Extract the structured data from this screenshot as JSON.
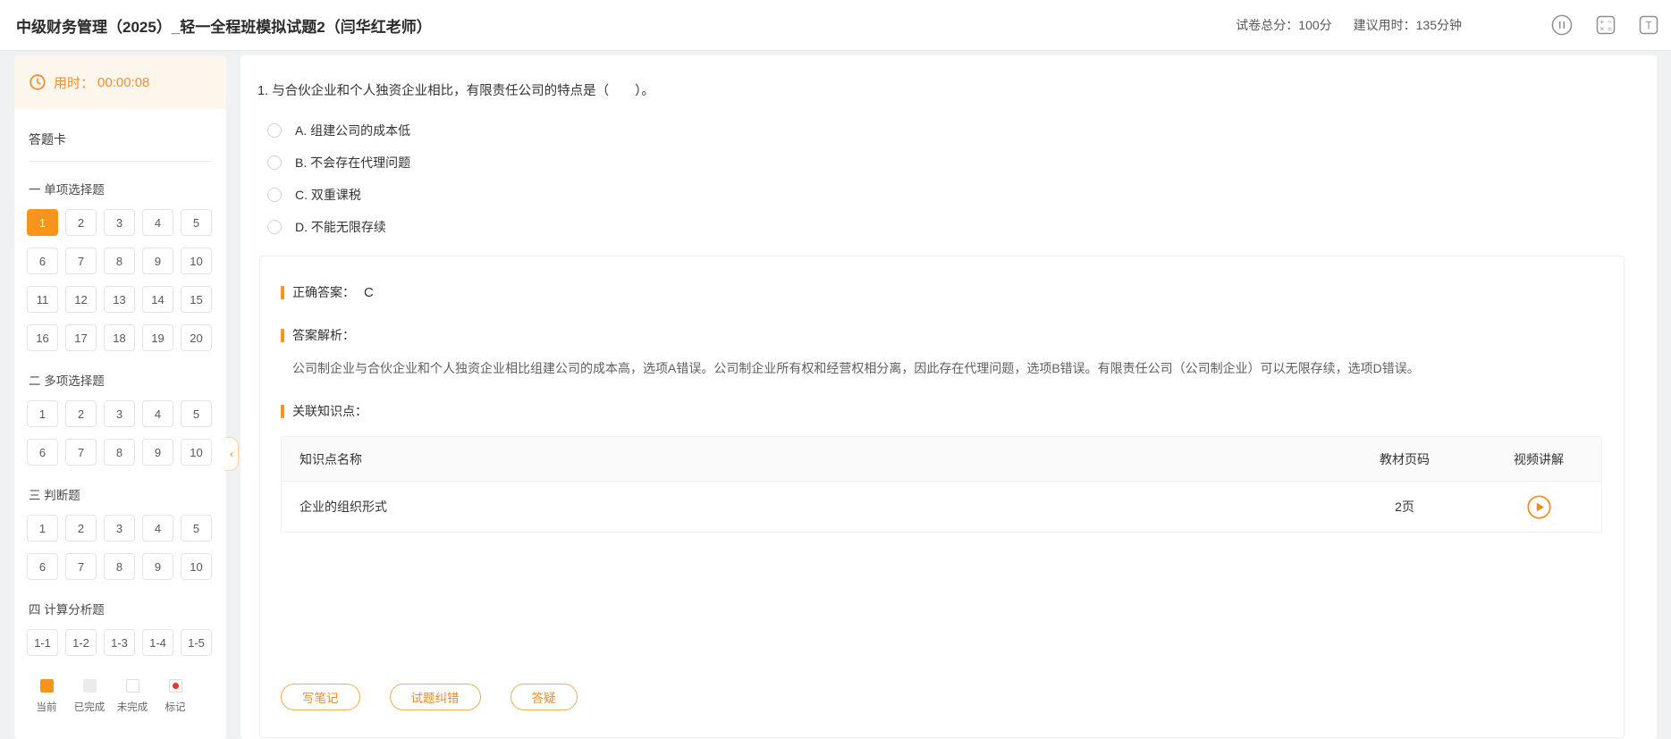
{
  "colors": {
    "accent_orange": "#f7941e",
    "timer_orange": "#ee8f33",
    "marked_red": "#e8382d"
  },
  "header": {
    "title": "中级财务管理（2025）_轻一全程班模拟试题2（闫华红老师）",
    "total_score": "试卷总分：100分",
    "suggested_time": "建议用时：135分钟",
    "icons": [
      "pause-icon",
      "calculator-icon",
      "font-size-icon"
    ]
  },
  "sidebar": {
    "timer": {
      "icon": "clock-icon",
      "label": "用时：",
      "value": "00:00:08"
    },
    "card_title": "答题卡",
    "sections": [
      {
        "title": "一 单项选择题",
        "active": "1",
        "items": [
          "1",
          "2",
          "3",
          "4",
          "5",
          "6",
          "7",
          "8",
          "9",
          "10",
          "11",
          "12",
          "13",
          "14",
          "15",
          "16",
          "17",
          "18",
          "19",
          "20"
        ]
      },
      {
        "title": "二 多项选择题",
        "items": [
          "1",
          "2",
          "3",
          "4",
          "5",
          "6",
          "7",
          "8",
          "9",
          "10"
        ]
      },
      {
        "title": "三 判断题",
        "items": [
          "1",
          "2",
          "3",
          "4",
          "5",
          "6",
          "7",
          "8",
          "9",
          "10"
        ]
      },
      {
        "title": "四 计算分析题",
        "items": [
          "1-1",
          "1-2",
          "1-3",
          "1-4",
          "1-5"
        ]
      }
    ],
    "legend": [
      {
        "type": "current",
        "label": "当前"
      },
      {
        "type": "done",
        "label": "已完成"
      },
      {
        "type": "todo",
        "label": "未完成"
      },
      {
        "type": "marked",
        "label": "标记"
      }
    ],
    "collapse_glyph": "‹"
  },
  "question": {
    "text": "1. 与合伙企业和个人独资企业相比，有限责任公司的特点是（　　）。",
    "options": [
      "A. 组建公司的成本低",
      "B. 不会存在代理问题",
      "C. 双重课税",
      "D. 不能无限存续"
    ]
  },
  "answer": {
    "correct_label": "正确答案：",
    "correct_value": "C",
    "analysis_label": "答案解析：",
    "analysis_text": "公司制企业与合伙企业和个人独资企业相比组建公司的成本高，选项A错误。公司制企业所有权和经营权相分离，因此存在代理问题，选项B错误。有限责任公司（公司制企业）可以无限存续，选项D错误。",
    "knowledge_label": "关联知识点：",
    "table": {
      "headers": [
        "知识点名称",
        "教材页码",
        "视频讲解"
      ],
      "rows": [
        {
          "name": "企业的组织形式",
          "page": "2页",
          "video_icon": "play-icon"
        }
      ]
    },
    "actions": [
      "写笔记",
      "试题纠错",
      "答疑"
    ]
  }
}
